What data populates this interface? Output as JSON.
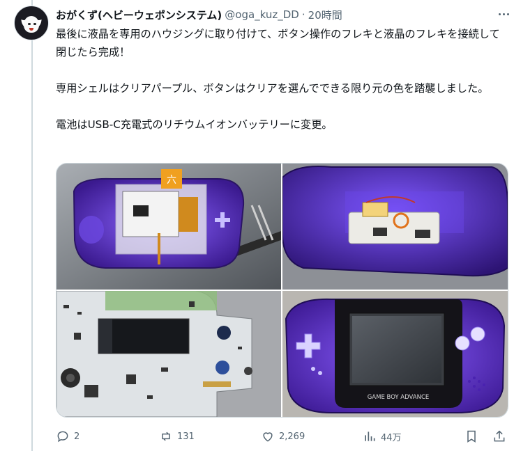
{
  "tweet": {
    "author_name": "おがくず(ヘビーウェポンシステム)",
    "handle": "@oga_kuz_DD",
    "separator": "·",
    "time": "20時間",
    "text": "最後に液晶を専用のハウジングに取り付けて、ボタン操作のフレキと液晶のフレキを接続して閉じたら完成！\n\n専用シェルはクリアパープル、ボタンはクリアを選んでできる限り元の色を踏襲しました。\n\n電池はUSB-C充電式のリチウムイオンバッテリーに変更。"
  },
  "media": {
    "device_label": "GAME BOY ADVANCE",
    "images": [
      {
        "icon": "photo-shell-with-lcd-board"
      },
      {
        "icon": "photo-shell-with-battery-board"
      },
      {
        "icon": "photo-mainboard"
      },
      {
        "icon": "photo-finished-console"
      }
    ]
  },
  "actions": {
    "reply_count": "2",
    "retweet_count": "131",
    "like_count": "2,269",
    "views_count": "44万"
  },
  "colors": {
    "accent": "#1d9bf0",
    "text": "#0f1419",
    "secondary_text": "#536471",
    "border": "#cfd9de",
    "shell_purple": "#5b2fc0"
  }
}
